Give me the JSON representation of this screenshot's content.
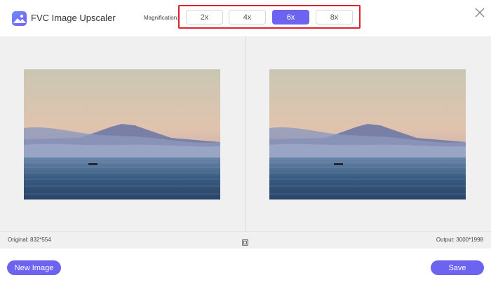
{
  "app": {
    "title": "FVC Image Upscaler",
    "logo_icon": "photo-logo-icon"
  },
  "magnification": {
    "label": "Magnification:",
    "options": [
      "2x",
      "4x",
      "6x",
      "8x"
    ],
    "selected": "6x",
    "highlight_color": "#d9232d"
  },
  "preview": {
    "original_label": "Original: 832*554",
    "output_label": "Output: 3000*1998",
    "compare_icon": "compare-icon"
  },
  "footer": {
    "new_image_label": "New Image",
    "save_label": "Save"
  },
  "colors": {
    "accent": "#6c63f0",
    "panel_bg": "#f0f0f0"
  }
}
